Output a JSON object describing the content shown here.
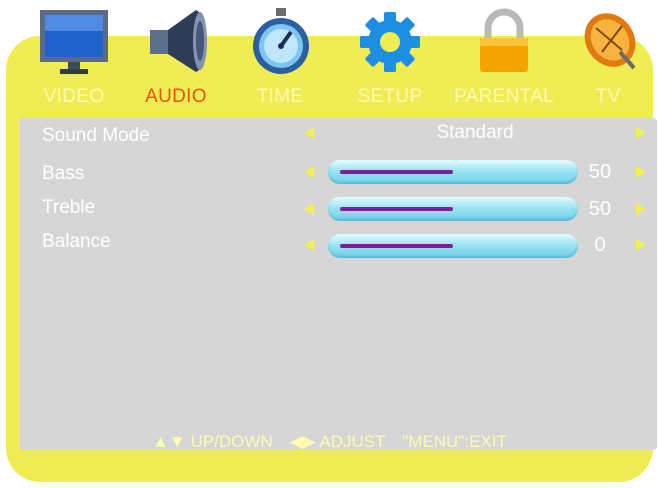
{
  "tabs": [
    {
      "label": "VIDEO",
      "icon": "monitor-icon",
      "active": false
    },
    {
      "label": "AUDIO",
      "icon": "speaker-icon",
      "active": true
    },
    {
      "label": "TIME",
      "icon": "stopwatch-icon",
      "active": false
    },
    {
      "label": "SETUP",
      "icon": "gear-icon",
      "active": false
    },
    {
      "label": "PARENTAL",
      "icon": "lock-icon",
      "active": false
    },
    {
      "label": "TV",
      "icon": "satellite-dish-icon",
      "active": false
    }
  ],
  "settings": {
    "sound_mode": {
      "label": "Sound Mode",
      "value": "Standard"
    },
    "bass": {
      "label": "Bass",
      "value": "50",
      "level": 0.5
    },
    "treble": {
      "label": "Treble",
      "value": "50",
      "level": 0.5
    },
    "balance": {
      "label": "Balance",
      "value": "0",
      "level": 0.5
    }
  },
  "footer": {
    "updown": "UP/DOWN",
    "adjust": "ADJUST",
    "exit": "\"MENU\":EXIT"
  },
  "colors": {
    "frame": "#f0ec54",
    "panel": "#d6d6d6",
    "active_tab": "#e8560e",
    "inactive_tab": "#fbfcb0",
    "slider_fill": "#7d1f9a"
  }
}
